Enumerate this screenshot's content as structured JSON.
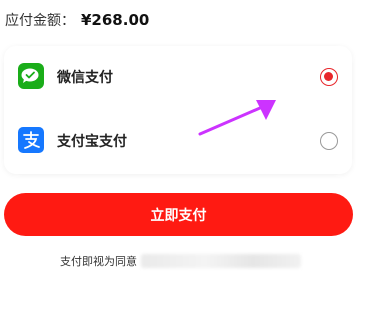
{
  "payment": {
    "amount_label": "应付金额：",
    "amount_value": "¥268.00"
  },
  "options": [
    {
      "label": "微信支付",
      "icon": "wechat-icon",
      "checked": true
    },
    {
      "label": "支付宝支付",
      "icon": "alipay-icon",
      "checked": false
    }
  ],
  "pay_button": {
    "label": "立即支付"
  },
  "agreement": {
    "text": "支付即视为同意"
  },
  "colors": {
    "accent": "#e8262b",
    "button": "#ff1a12",
    "wechat": "#1aad19",
    "alipay": "#1678ff",
    "annotation_arrow": "#cc33ff"
  }
}
